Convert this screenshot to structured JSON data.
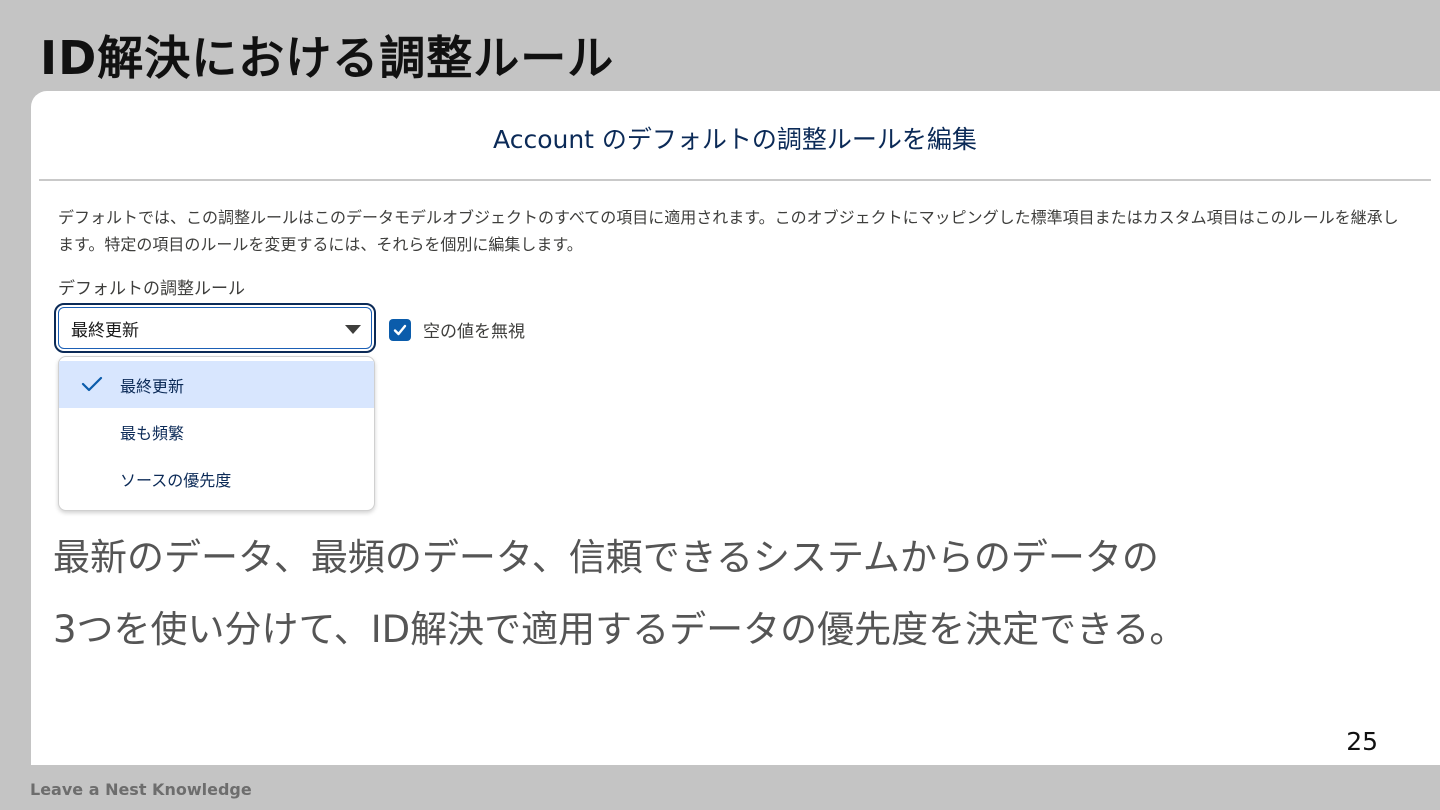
{
  "slide": {
    "title": "ID解決における調整ルール",
    "body_lines": [
      "最新のデータ、最頻のデータ、信頼できるシステムからのデータの",
      "3つを使い分けて、ID解決で適用するデータの優先度を決定できる。"
    ],
    "page_number": "25",
    "footer": "Leave a Nest Knowledge"
  },
  "modal": {
    "title": "Account のデフォルトの調整ルールを編集",
    "description": "デフォルトでは、この調整ルールはこのデータモデルオブジェクトのすべての項目に適用されます。このオブジェクトにマッピングした標準項目またはカスタム項目はこのルールを継承します。特定の項目のルールを変更するには、それらを個別に編集します。",
    "field_label": "デフォルトの調整ルール",
    "selected_value": "最終更新",
    "checkbox": {
      "label": "空の値を無視",
      "checked": true
    },
    "options": [
      {
        "label": "最終更新",
        "selected": true
      },
      {
        "label": "最も頻繁",
        "selected": false
      },
      {
        "label": "ソースの優先度",
        "selected": false
      }
    ],
    "icons": {
      "checkbox": "checkmark-icon",
      "caret": "caret-down-icon",
      "option_check": "check-icon"
    },
    "colors": {
      "accent": "#0b5cab",
      "selected_bg": "#d8e6fe",
      "title": "#0b2a57"
    }
  }
}
